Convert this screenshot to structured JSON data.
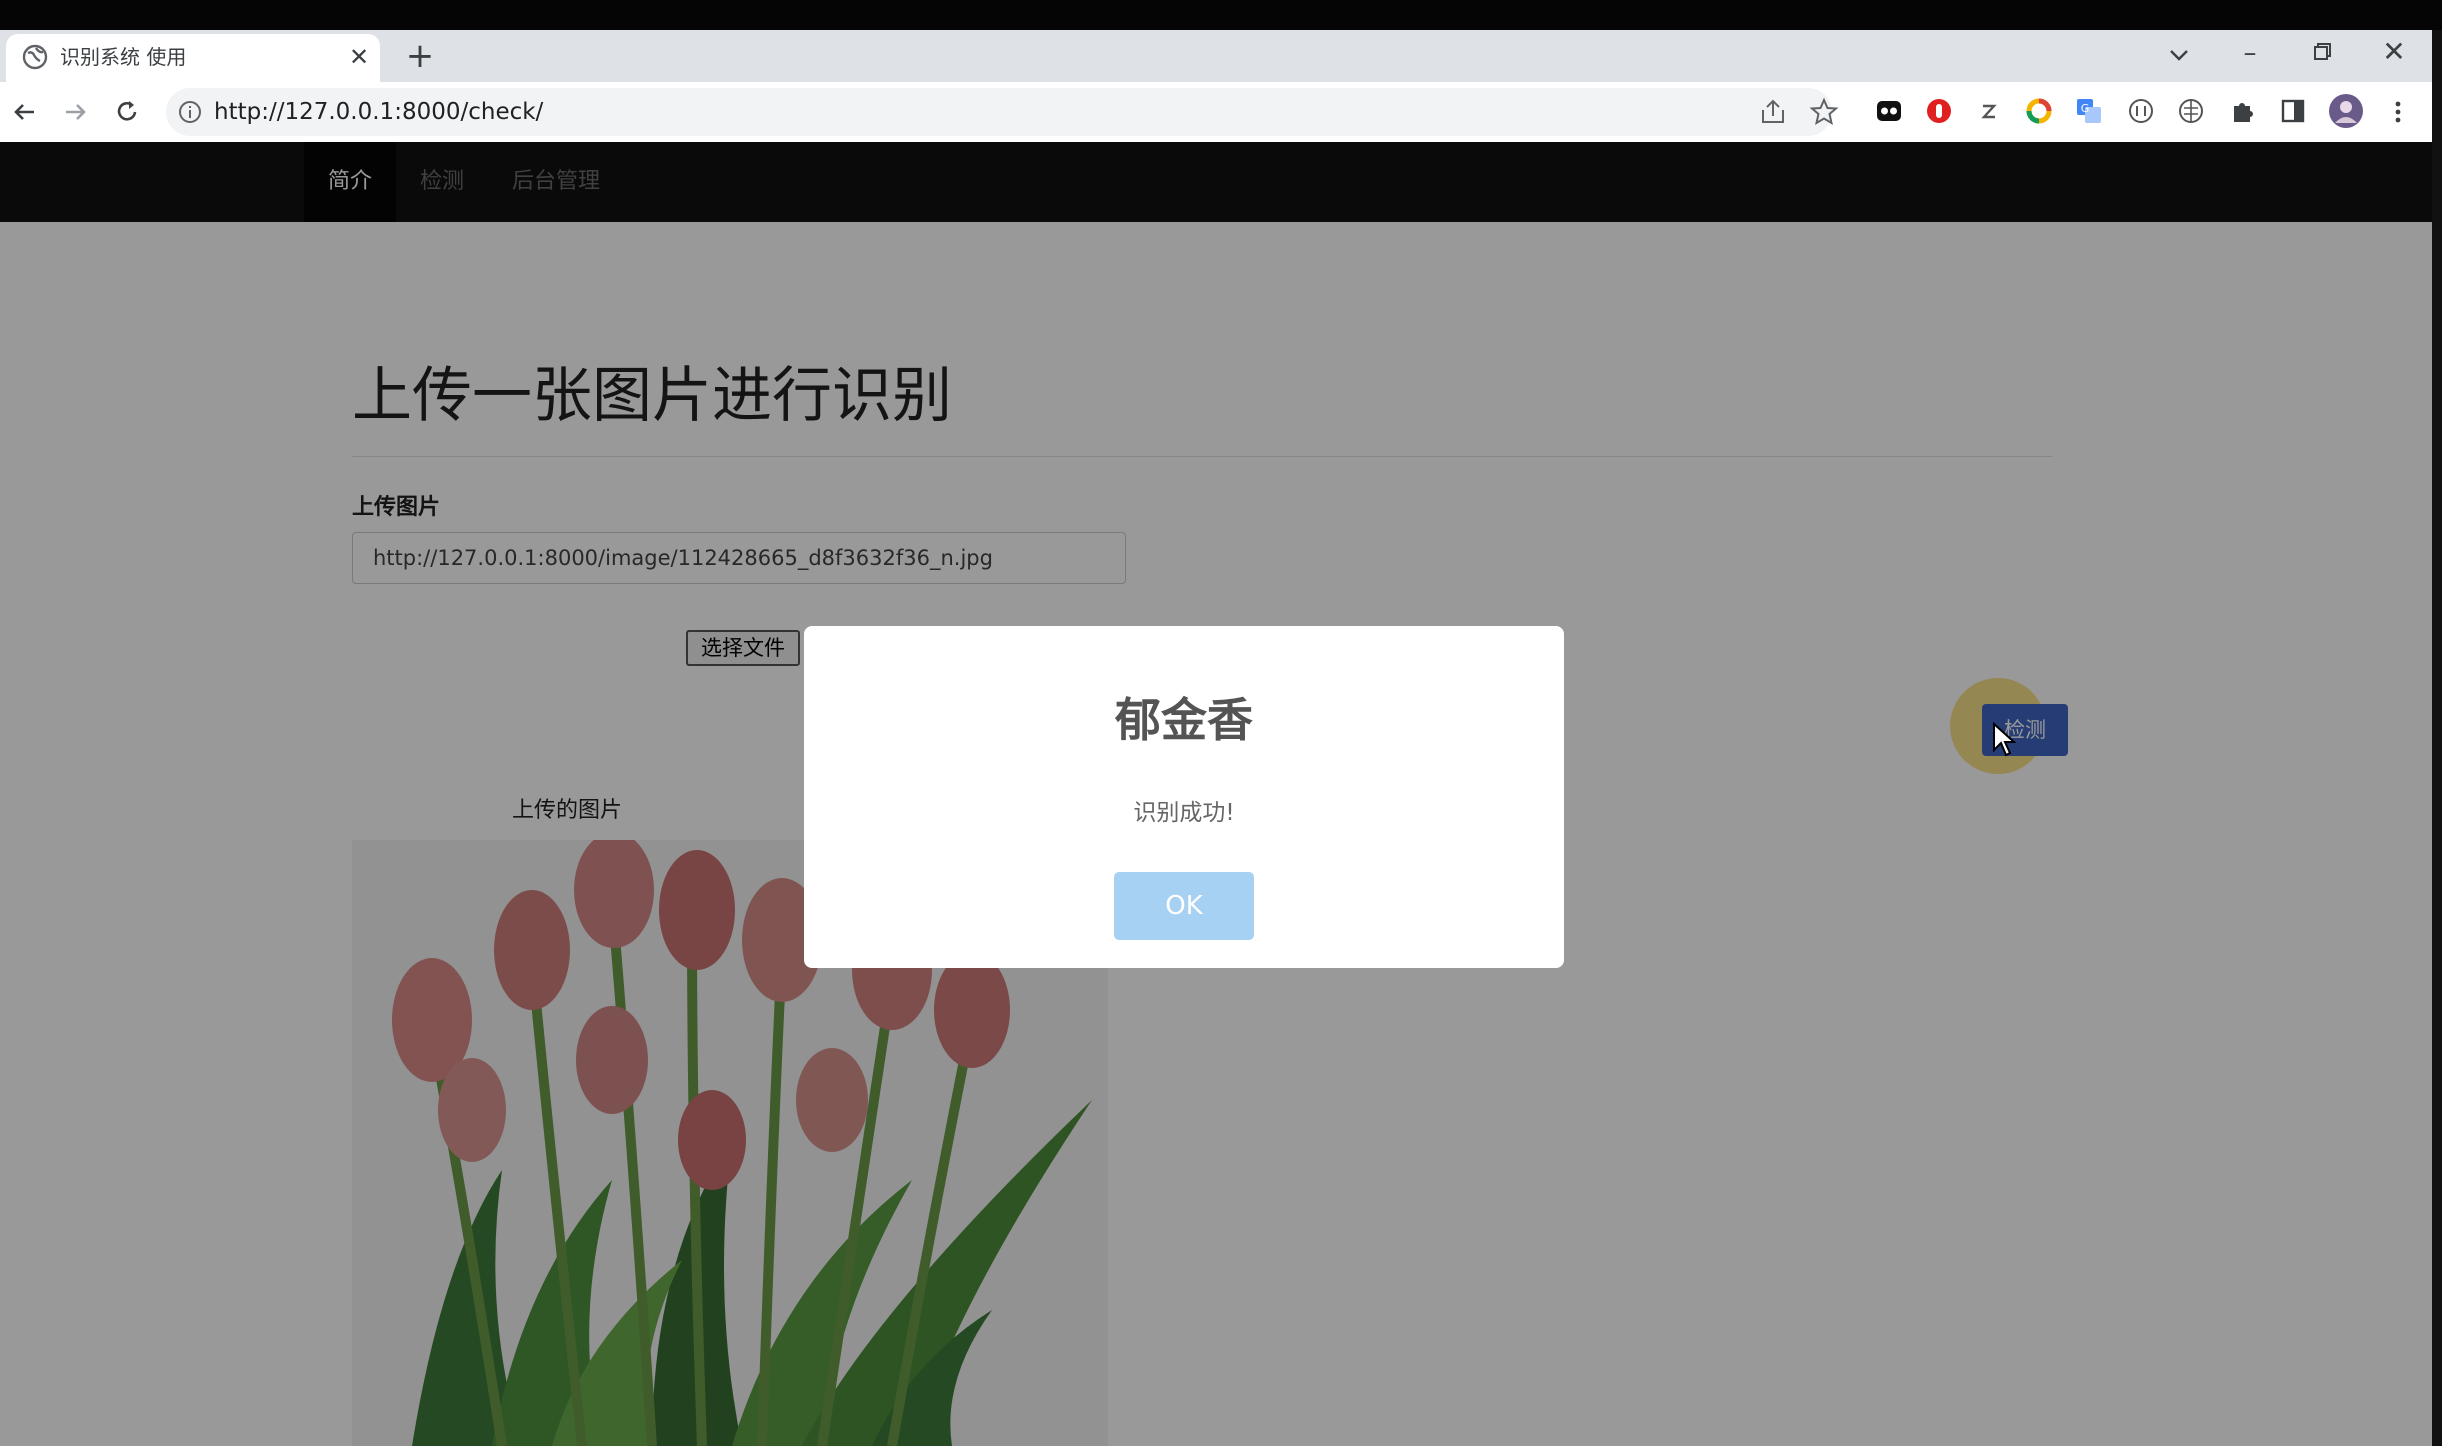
{
  "browser": {
    "tab_title": "识别系统 使用",
    "tab_close_glyph": "✕",
    "new_tab_glyph": "+",
    "minimize_glyph": "–",
    "close_glyph": "✕",
    "url": "http://127.0.0.1:8000/check/",
    "extensions": [
      "tab-manager-icon",
      "adblock-icon",
      "zotero-icon",
      "colorful-ring-icon",
      "translate-icon",
      "grid-icon",
      "globe-ext-icon",
      "puzzle-icon",
      "sidepanel-icon",
      "profile-avatar"
    ]
  },
  "site_nav": {
    "items": [
      {
        "label": "简介",
        "active": true
      },
      {
        "label": "检测",
        "active": false
      },
      {
        "label": "后台管理",
        "active": false
      }
    ]
  },
  "page": {
    "heading": "上传一张图片进行识别",
    "upload_label": "上传图片",
    "upload_value": "http://127.0.0.1:8000/image/112428665_d8f3632f36_n.jpg",
    "choose_file_label": "选择文件",
    "detect_button_label": "检测",
    "uploaded_caption": "上传的图片"
  },
  "dialog": {
    "title": "郁金香",
    "text": "识别成功!",
    "ok_label": "OK"
  },
  "colors": {
    "accent_blue": "#3f64c4",
    "ok_button": "#a7d1f3",
    "nav_bg": "#121212"
  }
}
